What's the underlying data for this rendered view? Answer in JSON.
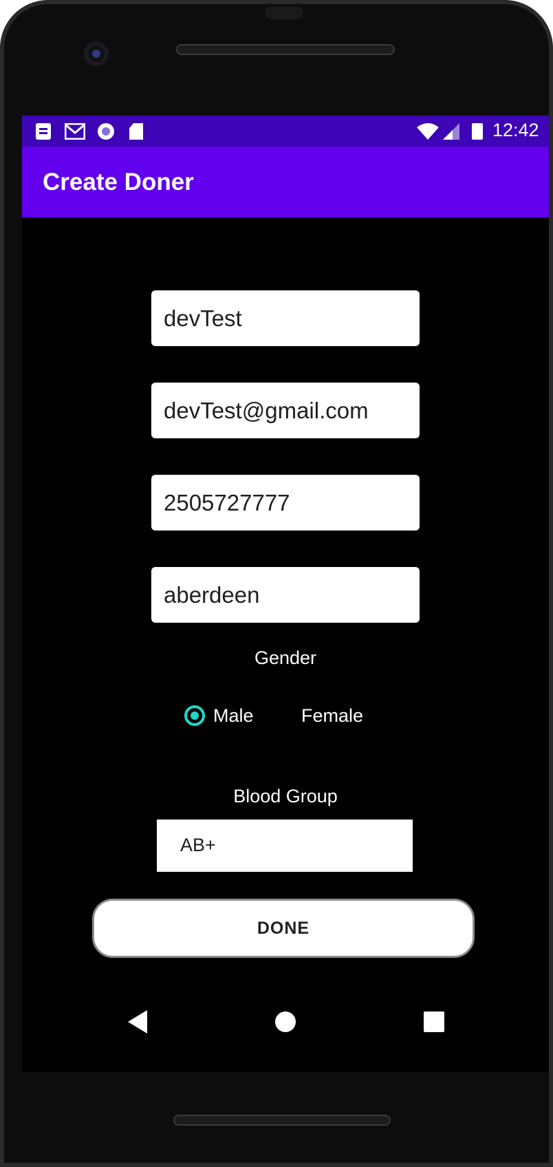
{
  "status_bar": {
    "time": "12:42",
    "icons": [
      "notes-icon",
      "gmail-icon",
      "circle-app-icon",
      "sd-card-icon",
      "wifi-icon",
      "signal-icon",
      "battery-icon"
    ],
    "background": "#3d05b5"
  },
  "app_bar": {
    "title": "Create Doner",
    "background": "#6200ee"
  },
  "form": {
    "name": "devTest",
    "email": "devTest@gmail.com",
    "phone": "2505727777",
    "city": "aberdeen",
    "gender_label": "Gender",
    "gender_options": [
      {
        "label": "Male",
        "selected": true
      },
      {
        "label": "Female",
        "selected": false
      }
    ],
    "blood_group_label": "Blood Group",
    "blood_group_value": "AB+",
    "accent_color": "#1ed8c8"
  },
  "done_button": {
    "label": "DONE"
  },
  "nav_bar": {
    "buttons": [
      "back-icon",
      "home-icon",
      "recents-icon"
    ]
  }
}
